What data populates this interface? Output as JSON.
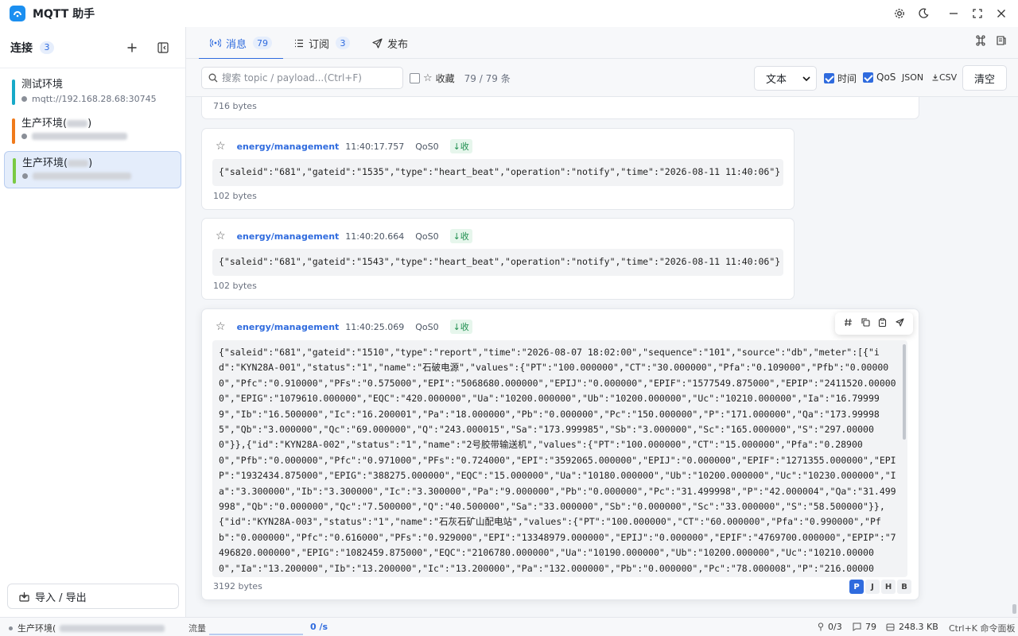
{
  "app": {
    "title": "MQTT 助手"
  },
  "sidebar": {
    "header": "连接",
    "count": "3",
    "footer_label": "导入 / 导出",
    "connections": [
      {
        "name": "测试环境",
        "url": "mqtt://192.168.28.68:30745",
        "color": "#17a9c8",
        "active": false
      },
      {
        "name": "生产环境(",
        "url": "",
        "color": "#f07a1b",
        "active": false
      },
      {
        "name": "生产环境(",
        "url": "",
        "color": "#7ac943",
        "active": true
      }
    ]
  },
  "tabs": [
    {
      "label": "消息",
      "badge": "79",
      "icon": "antenna-icon"
    },
    {
      "label": "订阅",
      "badge": "3",
      "icon": "list-icon"
    },
    {
      "label": "发布",
      "badge": "",
      "icon": "send-icon"
    }
  ],
  "toolbar": {
    "search_placeholder": "搜索 topic / payload...(Ctrl+F)",
    "favorite_label": "收藏",
    "count_text": "79 / 79 条",
    "format_select": "文本",
    "time_label": "时间",
    "qos_label": "QoS",
    "json_label": "JSON",
    "csv_label": "CSV",
    "clear_label": "清空"
  },
  "messages": [
    {
      "bytes": "716 bytes"
    },
    {
      "topic": "energy/management",
      "time": "11:40:17.757",
      "qos": "QoS0",
      "direction": "↓收",
      "payload": "{\"saleid\":\"681\",\"gateid\":\"1535\",\"type\":\"heart_beat\",\"operation\":\"notify\",\"time\":\"2026-08-11 11:40:06\"}",
      "bytes": "102 bytes"
    },
    {
      "topic": "energy/management",
      "time": "11:40:20.664",
      "qos": "QoS0",
      "direction": "↓收",
      "payload": "{\"saleid\":\"681\",\"gateid\":\"1543\",\"type\":\"heart_beat\",\"operation\":\"notify\",\"time\":\"2026-08-11 11:40:06\"}",
      "bytes": "102 bytes"
    },
    {
      "topic": "energy/management",
      "time": "11:40:25.069",
      "qos": "QoS0",
      "direction": "↓收",
      "payload_lines": [
        "{\"saleid\":\"681\",\"gateid\":\"1510\",\"type\":\"report\",\"time\":\"2026-08-07 18:02:00\",\"sequence\":\"101\",\"source\":\"db\",\"meter\":[{\"i",
        "d\":\"KYN28A-001\",\"status\":\"1\",\"name\":\"石破电源\",\"values\":{\"PT\":\"100.000000\",\"CT\":\"30.000000\",\"Pfa\":\"0.109000\",\"Pfb\":\"0.00000",
        "0\",\"Pfc\":\"0.910000\",\"PFs\":\"0.575000\",\"EPI\":\"5068680.000000\",\"EPIJ\":\"0.000000\",\"EPIF\":\"1577549.875000\",\"EPIP\":\"2411520.00000",
        "0\",\"EPIG\":\"1079610.000000\",\"EQC\":\"420.000000\",\"Ua\":\"10200.000000\",\"Ub\":\"10200.000000\",\"Uc\":\"10210.000000\",\"Ia\":\"16.79999",
        "9\",\"Ib\":\"16.500000\",\"Ic\":\"16.200001\",\"Pa\":\"18.000000\",\"Pb\":\"0.000000\",\"Pc\":\"150.000000\",\"P\":\"171.000000\",\"Qa\":\"173.99998",
        "5\",\"Qb\":\"3.000000\",\"Qc\":\"69.000000\",\"Q\":\"243.000015\",\"Sa\":\"173.999985\",\"Sb\":\"3.000000\",\"Sc\":\"165.000000\",\"S\":\"297.00000",
        "0\"}},{\"id\":\"KYN28A-002\",\"status\":\"1\",\"name\":\"2号胶带输送机\",\"values\":{\"PT\":\"100.000000\",\"CT\":\"15.000000\",\"Pfa\":\"0.28900",
        "0\",\"Pfb\":\"0.000000\",\"Pfc\":\"0.971000\",\"PFs\":\"0.724000\",\"EPI\":\"3592065.000000\",\"EPIJ\":\"0.000000\",\"EPIF\":\"1271355.000000\",\"EPI",
        "P\":\"1932434.875000\",\"EPIG\":\"388275.000000\",\"EQC\":\"15.000000\",\"Ua\":\"10180.000000\",\"Ub\":\"10200.000000\",\"Uc\":\"10230.000000\",\"I",
        "a\":\"3.300000\",\"Ib\":\"3.300000\",\"Ic\":\"3.300000\",\"Pa\":\"9.000000\",\"Pb\":\"0.000000\",\"Pc\":\"31.499998\",\"P\":\"42.000004\",\"Qa\":\"31.499",
        "998\",\"Qb\":\"0.000000\",\"Qc\":\"7.500000\",\"Q\":\"40.500000\",\"Sa\":\"33.000000\",\"Sb\":\"0.000000\",\"Sc\":\"33.000000\",\"S\":\"58.500000\"}},",
        "{\"id\":\"KYN28A-003\",\"status\":\"1\",\"name\":\"石灰石矿山配电站\",\"values\":{\"PT\":\"100.000000\",\"CT\":\"60.000000\",\"Pfa\":\"0.990000\",\"Pf",
        "b\":\"0.000000\",\"Pfc\":\"0.616000\",\"PFs\":\"0.929000\",\"EPI\":\"13348979.000000\",\"EPIJ\":\"0.000000\",\"EPIF\":\"4769700.000000\",\"EPIP\":\"7",
        "496820.000000\",\"EPIG\":\"1082459.875000\",\"EQC\":\"2106780.000000\",\"Ua\":\"10190.000000\",\"Ub\":\"10200.000000\",\"Uc\":\"10210.00000",
        "0\",\"Ia\":\"13.200000\",\"Ib\":\"13.200000\",\"Ic\":\"13.200000\",\"Pa\":\"132.000000\",\"Pb\":\"0.000000\",\"Pc\":\"78.000008\",\"P\":\"216.00000"
      ],
      "bytes": "3192 bytes",
      "formats": [
        "P",
        "J",
        "H",
        "B"
      ]
    }
  ],
  "statusbar": {
    "connection": "生产环境(",
    "flow_label": "流量",
    "flow_rate": "0 /s",
    "subs": "0/3",
    "messages": "79",
    "size": "248.3 KB",
    "shortcut": "Ctrl+K 命令面板"
  }
}
